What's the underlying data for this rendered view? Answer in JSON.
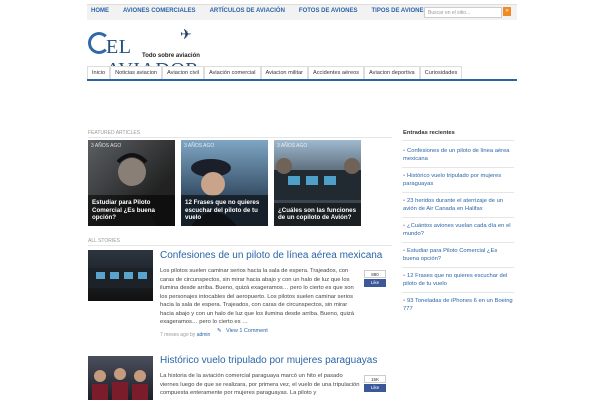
{
  "topnav": {
    "links": [
      "HOME",
      "AVIONES COMERCIALES",
      "ARTÍCULOS DE AVIACIÓN",
      "FOTOS DE AVIONES",
      "TIPOS DE AVIONES"
    ],
    "search_placeholder": "Buscar en el sitio..."
  },
  "logo": {
    "name": "EL AVIADOR",
    "tagline": "Todo sobre aviación"
  },
  "mainnav": [
    "Inicio",
    "Noticias aviacion",
    "Aviacion civil",
    "Aviación comercial",
    "Aviacion militar",
    "Accidentes aéreos",
    "Aviacion deportiva",
    "Curiosidades"
  ],
  "featured": {
    "label": "FEATURED ARTICLES",
    "items": [
      {
        "age": "3 AÑOS AGO",
        "title": "Estudiar para Piloto Comercial ¿Es buena opción?"
      },
      {
        "age": "3 AÑOS AGO",
        "title": "12 Frases que no quieres escuchar del piloto de tu vuelo"
      },
      {
        "age": "3 AÑOS AGO",
        "title": "¿Cuáles son las funciones de un copiloto de Avión?"
      }
    ]
  },
  "stories": {
    "label": "ALL STORIES",
    "items": [
      {
        "title": "Confesiones de un piloto de línea aérea mexicana",
        "text": "Los pilotos suelen caminar serios hacia la sala de espera. Trajeados, con caras de circunspectos, sin mirar hacia abajo y con un halo de luz que los ilumina desde arriba. Bueno, quizá exageramos… pero lo cierto es que son los personajes intocables del aeropuerto.  Los pilotos suelen caminar serios hacia la sala de espera. Trajeados, con caras de circunspectos, sin mirar hacia abajo y con un halo de luz que los ilumina desde arriba. Bueno, quizá exageramos… pero lo cierto es …",
        "meta_prefix": "7 meses ago by",
        "author": "admin",
        "comments": "View 1 Comment",
        "share_count": "880",
        "share_label": "Like"
      },
      {
        "title": "Histórico vuelo tripulado por mujeres paraguayas",
        "text": "La historia de la aviación comercial paraguaya marcó un hito el pasado viernes luego de que se realizara, por primera vez, el vuelo de una tripulación compuesta enteramente por mujeres paraguayas.  La piloto y",
        "share_count": "15K",
        "share_label": "Like"
      }
    ]
  },
  "sidebar": {
    "title": "Entradas recientes",
    "items": [
      "Confesiones de un piloto de línea aérea mexicana",
      "Histórico vuelo tripulado por mujeres paraguayas",
      "23 heridos durante el aterrizaje de un avión de Air Canada en Halifax",
      "¿Cuántos aviones vuelan cada día en el mundo?",
      "Estudiar para Piloto Comercial ¿Es buena opción?",
      "12 Frases que no quieres escuchar del piloto de tu vuelo",
      "93 Toneladas de iPhones 6 en un Boeing 777"
    ]
  },
  "colors": {
    "link": "#2a64a8",
    "accent": "#f08a24",
    "facebook": "#3b5998"
  }
}
